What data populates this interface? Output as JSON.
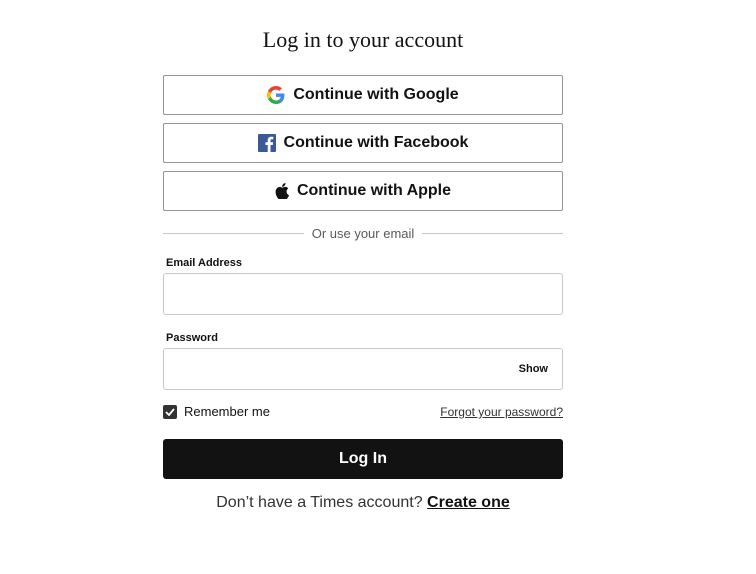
{
  "page": {
    "title": "Log in to your account"
  },
  "social": [
    {
      "label": "Continue with Google",
      "icon": "google-icon"
    },
    {
      "label": "Continue with Facebook",
      "icon": "facebook-icon"
    },
    {
      "label": "Continue with Apple",
      "icon": "apple-icon"
    }
  ],
  "divider": {
    "text": "Or use your email"
  },
  "email": {
    "label": "Email Address",
    "value": "",
    "placeholder": ""
  },
  "password": {
    "label": "Password",
    "value": "",
    "placeholder": "",
    "show_label": "Show"
  },
  "remember": {
    "label": "Remember me",
    "checked": true
  },
  "forgot": {
    "label": "Forgot your password?"
  },
  "login": {
    "label": "Log In"
  },
  "signup": {
    "prompt": "Don’t have a Times account?",
    "link": "Create one"
  },
  "colors": {
    "button_bg": "#121212",
    "facebook": "#3b5998",
    "border": "#c7c7c7"
  }
}
